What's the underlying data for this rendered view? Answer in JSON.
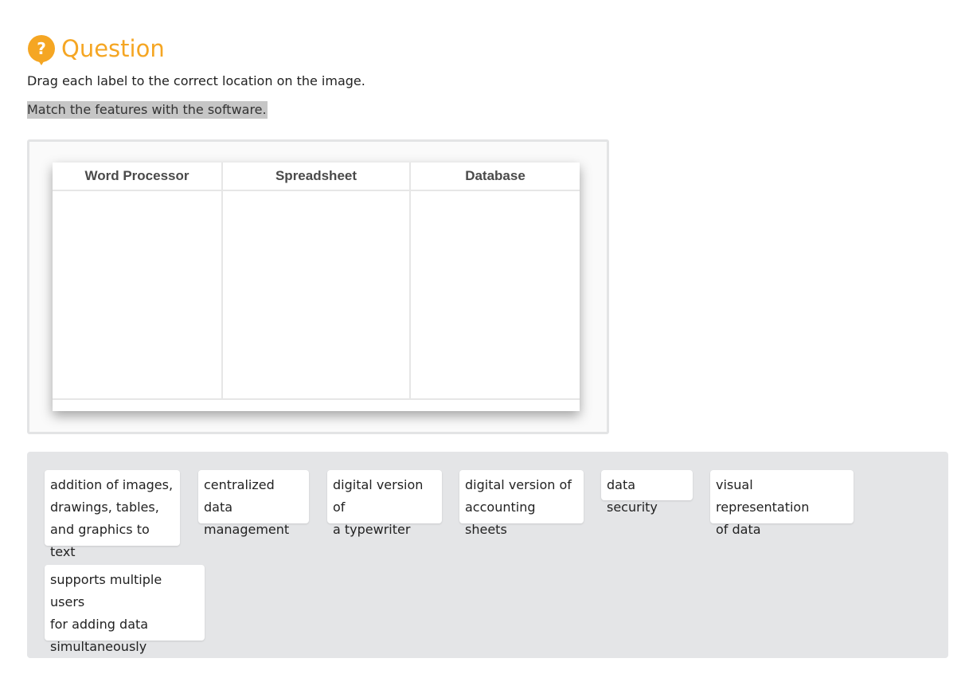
{
  "question": {
    "title": "Question",
    "instruction": "Drag each label to the correct location on the image.",
    "prompt": "Match the features with the software."
  },
  "table": {
    "columns": [
      "Word Processor",
      "Spreadsheet",
      "Database"
    ]
  },
  "labels": [
    "addition of images,\ndrawings, tables,\nand graphics to text",
    "centralized data\nmanagement",
    "digital version of\na typewriter",
    "digital version of\naccounting sheets",
    "data security",
    "visual representation\nof data",
    "supports multiple users\nfor adding data\nsimultaneously"
  ],
  "colors": {
    "accent": "#f5a623",
    "bank_bg": "#e4e5e7",
    "highlight": "#c6c6c6"
  }
}
